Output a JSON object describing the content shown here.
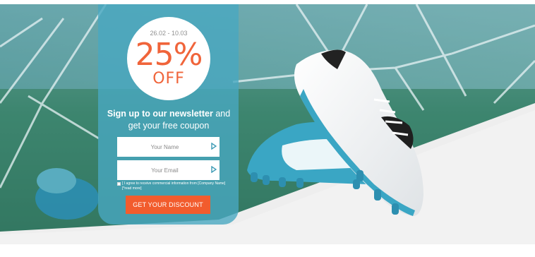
{
  "promo": {
    "dates": "26.02 - 10.03",
    "percent": "25%",
    "off": "OFF"
  },
  "headline": {
    "bold": "Sign up to our newsletter",
    "rest_line1": "and",
    "line2": "get your free coupon"
  },
  "form": {
    "name_placeholder": "Your Name",
    "email_placeholder": "Your Email",
    "consent": "[ I agree to receive commercial information from [Company Name] [*read more]",
    "submit_label": "GET YOUR DISCOUNT"
  },
  "colors": {
    "panel": "#48a8c0",
    "accent": "#f25c2d",
    "badge_text": "#f0643a"
  },
  "icons": {
    "field_arrow": "play-arrow-icon"
  }
}
